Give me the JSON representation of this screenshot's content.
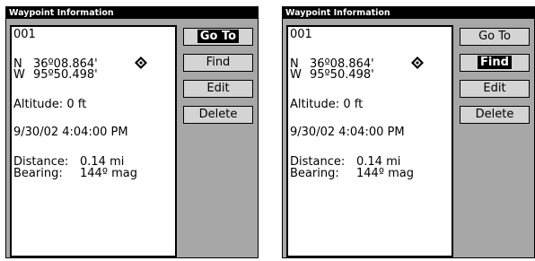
{
  "panels": [
    {
      "title": "Waypoint Information",
      "waypoint_id": "001",
      "latitude_hemisphere": "N",
      "latitude": "36º08.864'",
      "longitude_hemisphere": "W",
      "longitude": "95º50.498'",
      "altitude": "Altitude: 0 ft",
      "datetime": "9/30/02 4:04:00 PM",
      "distance_label": "Distance:",
      "distance_value": "0.14 mi",
      "bearing_label": "Bearing:",
      "bearing_value": "144º mag",
      "buttons": [
        "Go To",
        "Find",
        "Edit",
        "Delete"
      ],
      "selected_button": "Go To"
    },
    {
      "title": "Waypoint Information",
      "waypoint_id": "001",
      "latitude_hemisphere": "N",
      "latitude": "36º08.864'",
      "longitude_hemisphere": "W",
      "longitude": "95º50.498'",
      "altitude": "Altitude: 0 ft",
      "datetime": "9/30/02 4:04:00 PM",
      "distance_label": "Distance:",
      "distance_value": "0.14 mi",
      "bearing_label": "Bearing:",
      "bearing_value": "144º mag",
      "buttons": [
        "Go To",
        "Find",
        "Edit",
        "Delete"
      ],
      "selected_button": "Find"
    }
  ],
  "icons": {
    "waypoint_symbol": "waypoint-diamond-icon"
  }
}
